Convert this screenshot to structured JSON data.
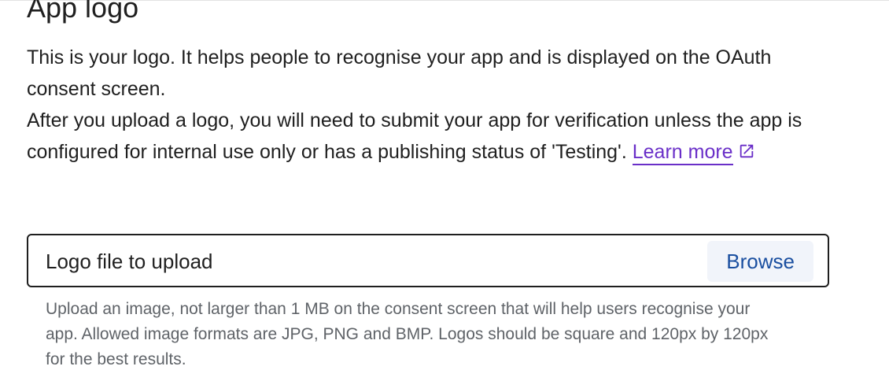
{
  "section": {
    "title": "App logo"
  },
  "description": {
    "line1": "This is your logo. It helps people to recognise your app and is displayed on the OAuth consent screen.",
    "line2_text": "After you upload a logo, you will need to submit your app for verification unless the app is configured for internal use only or has a publishing status of 'Testing'.",
    "learn_more_label": "Learn more",
    "link_icon": "external-link-icon"
  },
  "upload": {
    "label": "Logo file to upload",
    "browse_label": "Browse",
    "helper_text": "Upload an image, not larger than 1 MB on the consent screen that will help users recognise your app. Allowed image formats are JPG, PNG and BMP. Logos should be square and 120px by 120px for the best results."
  },
  "colors": {
    "link": "#6a2fc8",
    "button_text": "#1a4fa0",
    "button_bg": "#f1f4fa",
    "helper_text": "#5f6368"
  }
}
